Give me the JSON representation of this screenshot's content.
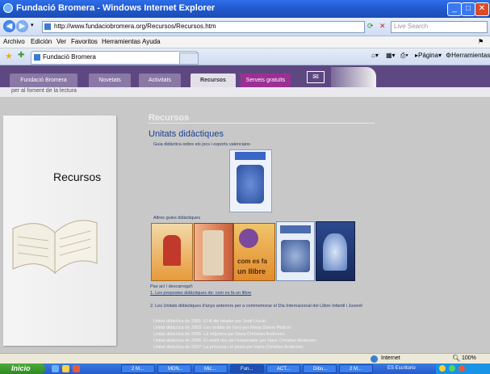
{
  "window": {
    "title": "Fundació Bromera - Windows Internet Explorer"
  },
  "address": {
    "url": "http://www.fundaciobromera.org/Recursos/Recursos.htm",
    "search_placeholder": "Live Search"
  },
  "menu": {
    "items": [
      "Archivo",
      "Edición",
      "Ver",
      "Favoritos",
      "Herramientas",
      "Ayuda"
    ]
  },
  "tabs": {
    "active_tab": "Fundació Bromera",
    "page_label": "Página",
    "tools_label": "Herramientas"
  },
  "site_nav": {
    "items": [
      "Fundació Bromera",
      "Novetats",
      "Activitats",
      "Recursos",
      "Serveis gratuïts"
    ],
    "slogan": "per al foment de la lectura"
  },
  "sidebar": {
    "title": "Recursos"
  },
  "content": {
    "heading": "Recursos",
    "subheading": "Unitats didàctiques",
    "guide_intro": "Guia didàctica sobre els jocs i esports valencians",
    "other_guides": "Altres guies didàctiques",
    "book_cover_text": [
      "com es fa",
      "un llibre"
    ],
    "download_label": "Pas ací i descarrega't",
    "download_link": "1. Les propostes didàctiques de: com es fa un llibre",
    "older_units_text": "2. Les Unitats didàctiques d'anys anteriors per a commemorar el Dia Internacional del Llibre Infantil i Juvenil",
    "unit_lines": [
      "Unitat didàctica de 2001: El fil del tabaler per Jordi Llucat",
      "Unitat didàctica de 2003: Les unitats de l'any per Maria Dolors Pellicer",
      "Unitat didàctica de 2005: La mitjotera per Hans Christian Andersen",
      "Unitat didàctica de 2006: El vestit nou de l'emperador per Hans Christian Andersen",
      "Unitat didàctica de 2007: La princesa i el pèsol per Hans Christian Andersen"
    ]
  },
  "status": {
    "zone": "Internet",
    "zoom": "100%"
  },
  "taskbar": {
    "start": "Inicio",
    "items": [
      "2 M...",
      "MDN...",
      "Mic...",
      "Fun...",
      "ACT...",
      "Dibu...",
      "2 M..."
    ],
    "tray_text": "ES  Escritorio"
  },
  "colors": {
    "site_nav": "#5e4882",
    "page_bg": "#c8c8c8",
    "accent_heading": "#1a3f8f"
  }
}
